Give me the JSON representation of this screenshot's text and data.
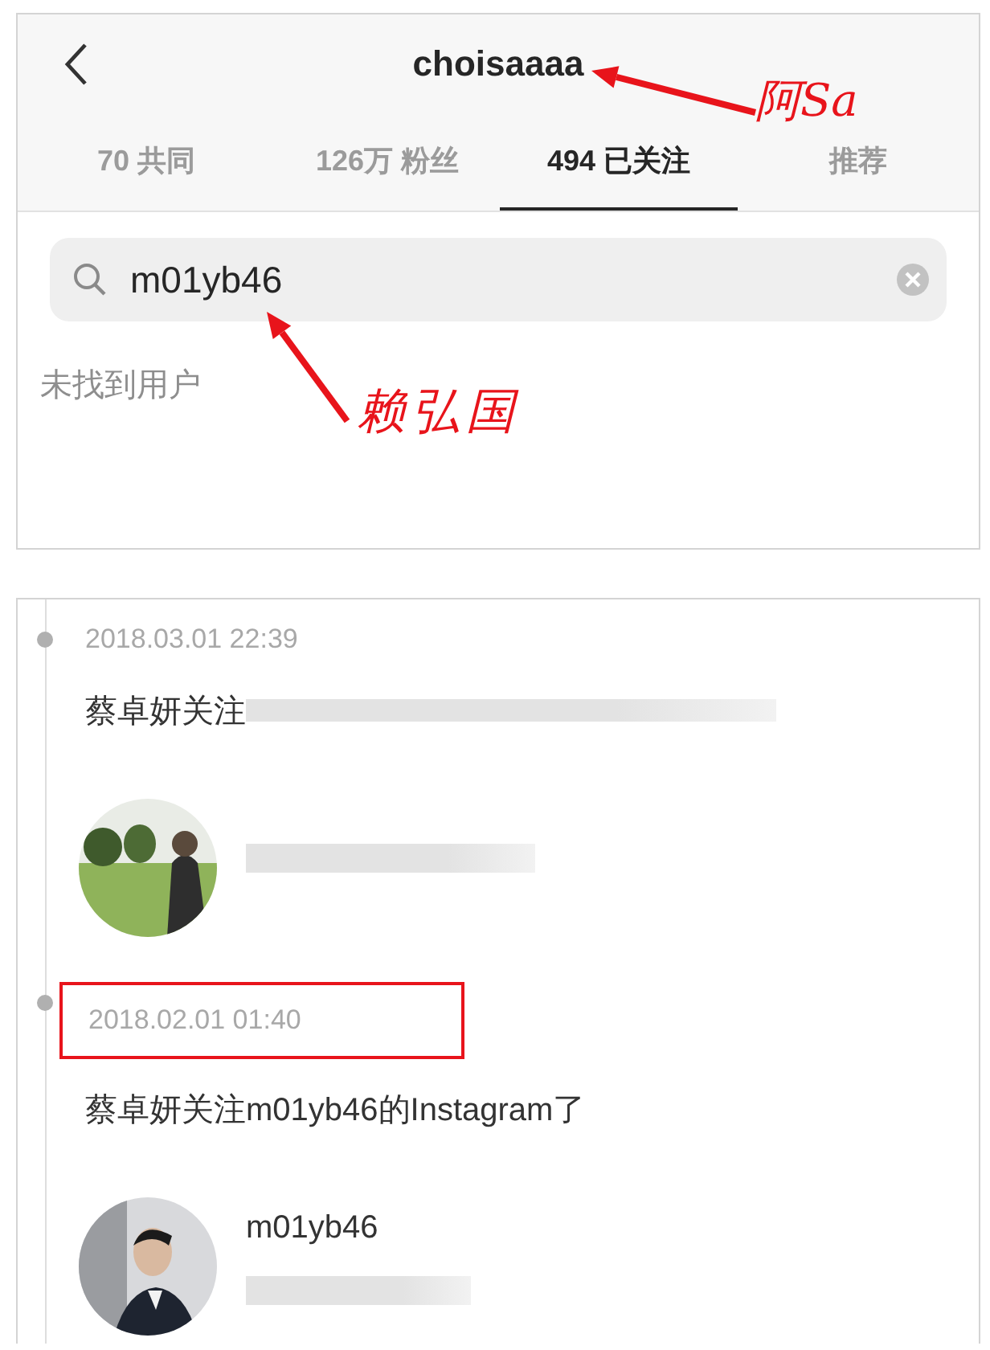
{
  "profile_panel": {
    "title": "choisaaaa",
    "tabs": [
      {
        "label": "70 共同",
        "selected": false
      },
      {
        "label": "126万 粉丝",
        "selected": false
      },
      {
        "label": "494 已关注",
        "selected": true
      },
      {
        "label": "推荐",
        "selected": false
      }
    ],
    "search": {
      "value": "m01yb46"
    },
    "empty_message": "未找到用户"
  },
  "timeline": [
    {
      "time": "2018.03.01 22:39",
      "highlighted": false,
      "text": "蔡卓妍关注",
      "text_redacted": true,
      "user": {
        "name_redacted": true
      }
    },
    {
      "time": "2018.02.01 01:40",
      "highlighted": true,
      "text": "蔡卓妍关注m01yb46的Instagram了",
      "user": {
        "name": "m01yb46",
        "bio_redacted": true
      }
    }
  ],
  "annotations": [
    {
      "text": "阿Sa"
    },
    {
      "text": "赖弘国"
    }
  ]
}
